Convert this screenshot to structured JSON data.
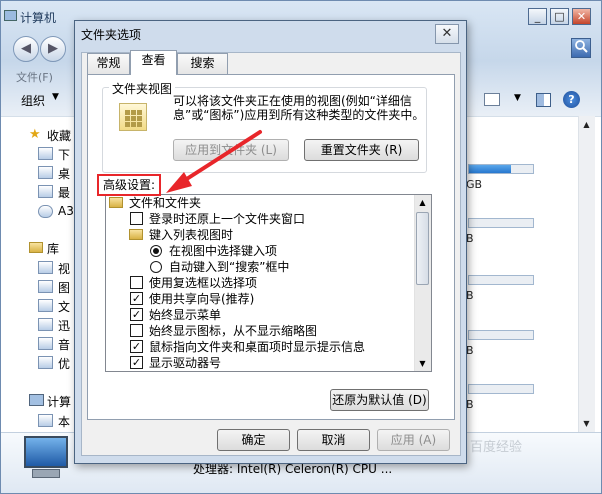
{
  "explorer": {
    "title": "计算机",
    "minimize": "_",
    "maximize": "□",
    "close": "✕",
    "menu_file": "文件(F)",
    "organize": "组织",
    "organize_caret": "▼",
    "view_caret": "▼",
    "help": "?",
    "back_icon": "◀",
    "forward_icon": "▶",
    "search_icon": "magnifier-icon",
    "sidebar": {
      "favorites": "收藏",
      "favorites_items": [
        "下",
        "桌",
        "最",
        "A3"
      ],
      "libraries": "库",
      "library_items": [
        "视",
        "图",
        "文",
        "迅",
        "音",
        "优"
      ],
      "computer": "计算",
      "computer_items": [
        "本"
      ]
    },
    "drives": [
      {
        "unit": "GB",
        "fill": 0.65
      },
      {
        "unit": "B",
        "fill": 0
      },
      {
        "unit": "B",
        "fill": 0
      },
      {
        "unit": "B",
        "fill": 0
      },
      {
        "unit": "B",
        "fill": 0
      }
    ],
    "scroll_up": "▲",
    "scroll_down": "▼",
    "processor": "处理器: Intel(R) Celeron(R) CPU ...",
    "watermark": "百度经验"
  },
  "dialog": {
    "title": "文件夹选项",
    "close": "✕",
    "tabs": [
      "常规",
      "查看",
      "搜索"
    ],
    "active_tab": "查看",
    "folder_view": {
      "label": "文件夹视图",
      "description": "可以将该文件夹正在使用的视图(例如“详细信息”或“图标”)应用到所有这种类型的文件夹中。",
      "apply_button": "应用到文件夹 (L)",
      "reset_button": "重置文件夹 (R)"
    },
    "advanced_label": "高级设置:",
    "advanced_items": [
      {
        "type": "folder",
        "text": "文件和文件夹",
        "level": 0
      },
      {
        "type": "check",
        "checked": false,
        "text": "登录时还原上一个文件夹窗口",
        "level": 1
      },
      {
        "type": "folder",
        "text": "键入列表视图时",
        "level": 1
      },
      {
        "type": "radio",
        "checked": true,
        "text": "在视图中选择键入项",
        "level": 2
      },
      {
        "type": "radio",
        "checked": false,
        "text": "自动键入到“搜索”框中",
        "level": 2
      },
      {
        "type": "check",
        "checked": false,
        "text": "使用复选框以选择项",
        "level": 1
      },
      {
        "type": "check",
        "checked": true,
        "text": "使用共享向导(推荐)",
        "level": 1
      },
      {
        "type": "check",
        "checked": true,
        "text": "始终显示菜单",
        "level": 1
      },
      {
        "type": "check",
        "checked": false,
        "text": "始终显示图标，从不显示缩略图",
        "level": 1
      },
      {
        "type": "check",
        "checked": true,
        "text": "鼠标指向文件夹和桌面项时显示提示信息",
        "level": 1
      },
      {
        "type": "check",
        "checked": true,
        "text": "显示驱动器号",
        "level": 1
      }
    ],
    "check_mark": "✓",
    "scroll_up": "▲",
    "scroll_down": "▼",
    "restore_defaults": "还原为默认值 (D)",
    "ok": "确定",
    "cancel": "取消",
    "apply": "应用 (A)",
    "annotation_color": "#e8262a"
  }
}
